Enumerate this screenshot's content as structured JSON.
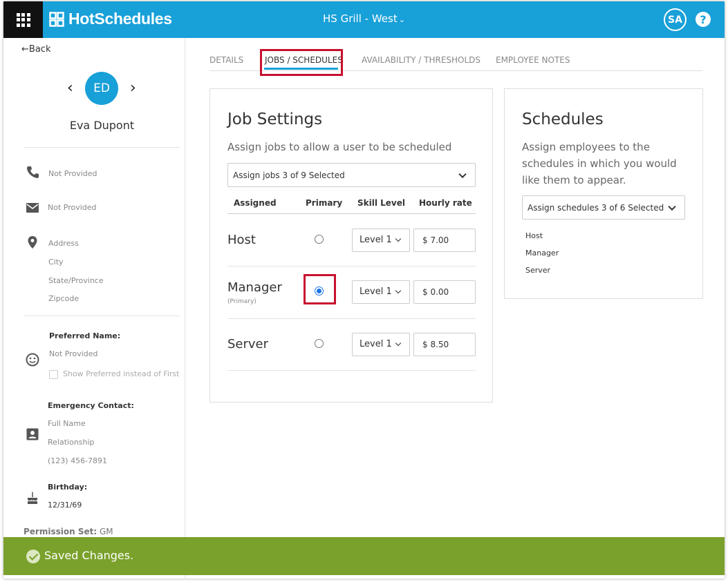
{
  "header": {
    "brand": "HotSchedules",
    "location": "HS Grill - West",
    "location_caret": "⌄",
    "user_initials": "SA",
    "help": "?"
  },
  "employee": {
    "back_label": "Back",
    "prev": "‹",
    "next": "›",
    "initials": "ED",
    "name": "Eva Dupont",
    "phone": "Not Provided",
    "email": "Not Provided",
    "address": {
      "line": "Address",
      "city": "City",
      "state": "State/Province",
      "zip": "Zipcode"
    },
    "preferred_name_label": "Preferred Name:",
    "preferred_name_value": "Not Provided",
    "show_preferred_label": "Show Preferred instead of First",
    "emergency_label": "Emergency Contact:",
    "emergency_name": "Full Name",
    "emergency_relationship": "Relationship",
    "emergency_phone": "(123) 456-7891",
    "birthday_label": "Birthday:",
    "birthday_value": "12/31/69",
    "permission_label": "Permission Set:",
    "permission_value": "GM"
  },
  "tabs": [
    {
      "label": "DETAILS"
    },
    {
      "label": "JOBS / SCHEDULES"
    },
    {
      "label": "AVAILABILITY / THRESHOLDS"
    },
    {
      "label": "EMPLOYEE NOTES"
    }
  ],
  "active_tab": "JOBS / SCHEDULES",
  "job_settings": {
    "title": "Job Settings",
    "subtitle": "Assign jobs to allow a user to be scheduled",
    "dropdown": "Assign jobs 3 of 9 Selected",
    "columns": [
      "Assigned",
      "Primary",
      "Skill Level",
      "Hourly rate"
    ],
    "jobs": [
      {
        "name": "Host",
        "sub": "",
        "primary": false,
        "level": "Level 1",
        "rate": "$ 7.00"
      },
      {
        "name": "Manager",
        "sub": "(Primary)",
        "primary": true,
        "level": "Level 1",
        "rate": "$ 0.00"
      },
      {
        "name": "Server",
        "sub": "",
        "primary": false,
        "level": "Level 1",
        "rate": "$ 8.50"
      }
    ]
  },
  "schedules": {
    "title": "Schedules",
    "subtitle": "Assign employees to the schedules in which you would like them to appear.",
    "dropdown": "Assign schedules 3 of 6 Selected",
    "items": [
      "Host",
      "Manager",
      "Server"
    ]
  },
  "toast": {
    "message": "Saved Changes."
  },
  "colors": {
    "brand": "#18a0d8",
    "highlight": "#c8102e",
    "toast": "#7aa12b",
    "radio_selected": "#1a73e8"
  }
}
